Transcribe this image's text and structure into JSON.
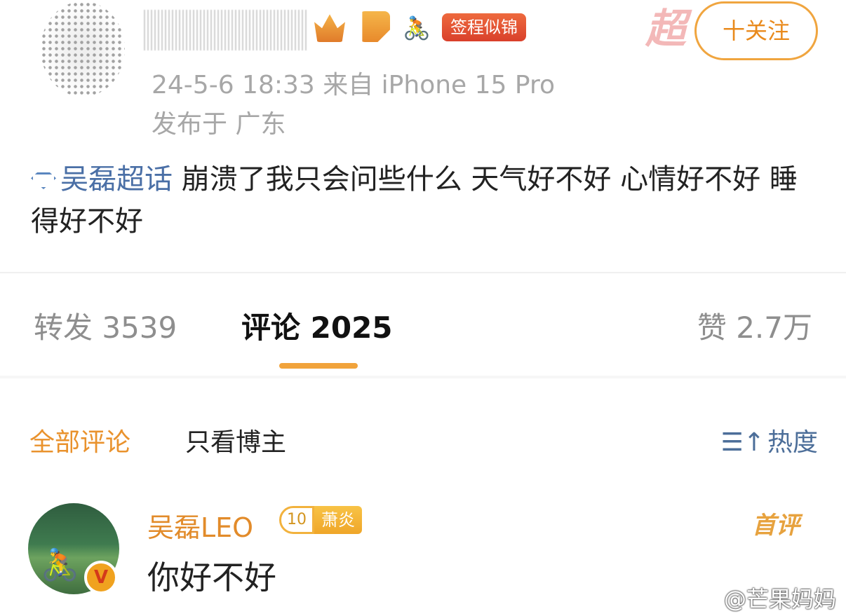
{
  "post": {
    "tag": "签程似锦",
    "follow_label": "十关注",
    "super_topic_watermark": "超",
    "time_device": "24-5-6 18:33  来自 iPhone 15 Pro",
    "location": "发布于 广东",
    "topic": "吴磊超话",
    "text_after_topic": " 崩溃了我只会问些什么 天气好不好 心情好不好 睡得好不好"
  },
  "stats": {
    "repost": "转发 3539",
    "comment": "评论 2025",
    "like": "赞 2.7万"
  },
  "filters": {
    "all": "全部评论",
    "host_only": "只看博主",
    "sort_icon": "☰↑",
    "sort": "热度"
  },
  "comment": {
    "user": "吴磊LEO",
    "level": "10",
    "level_name": "萧炎",
    "first_label": "首评",
    "verified": "V",
    "text": "你好不好"
  },
  "watermark": "@芒果妈妈"
}
